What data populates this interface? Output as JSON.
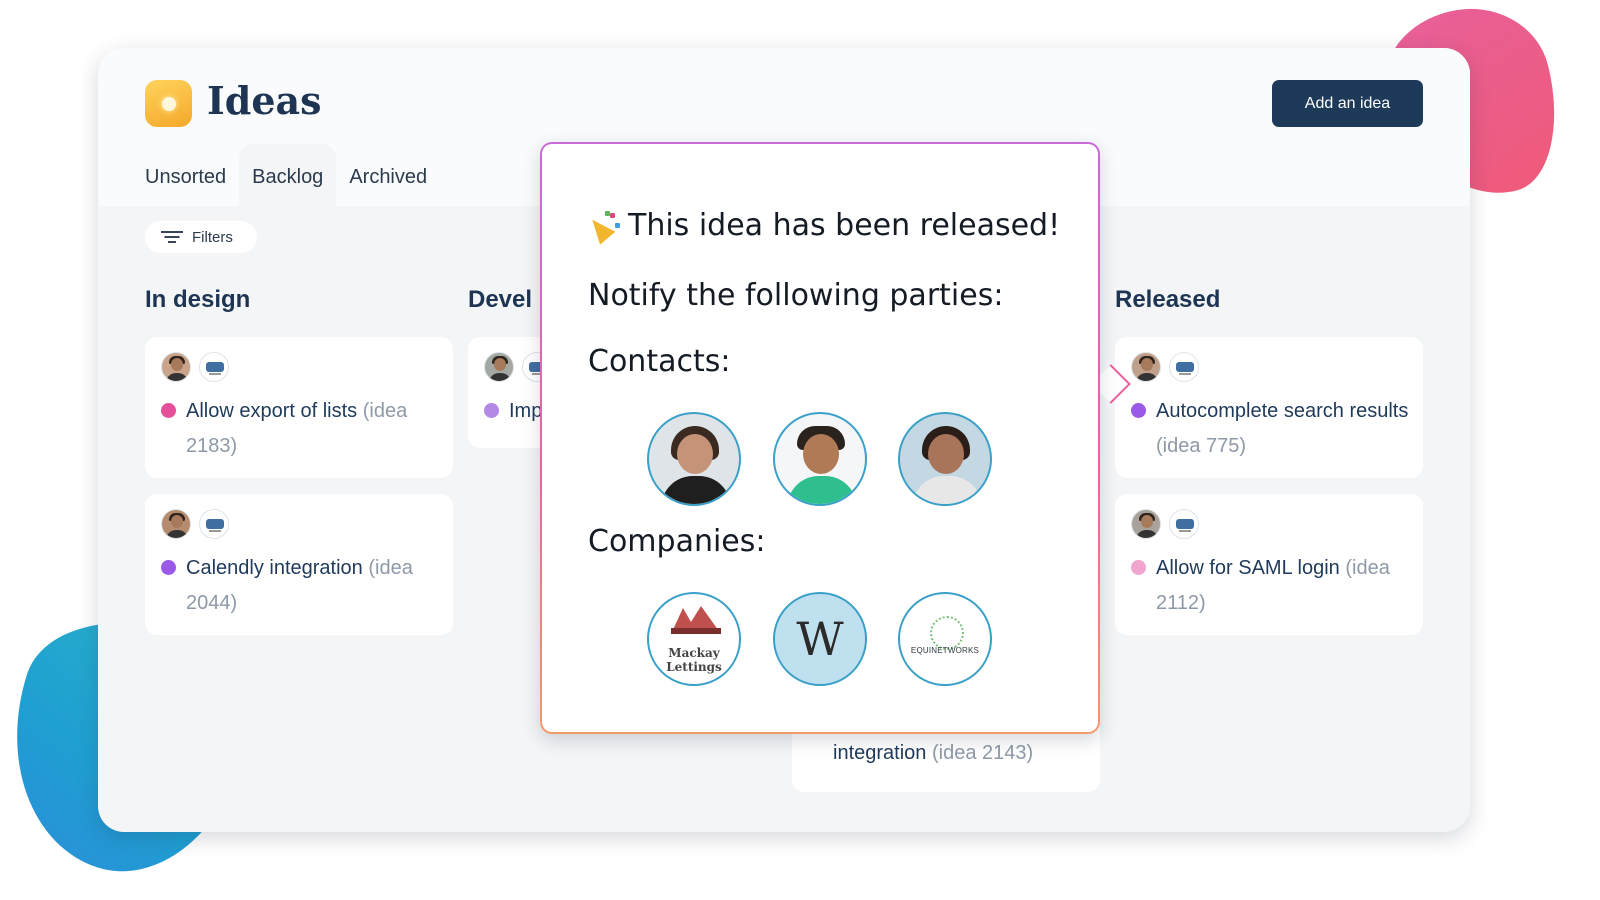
{
  "app": {
    "title": "Ideas",
    "add_button": "Add an idea"
  },
  "tabs": [
    {
      "label": "Unsorted",
      "active": false
    },
    {
      "label": "Backlog",
      "active": true
    },
    {
      "label": "Archived",
      "active": false
    }
  ],
  "filters": {
    "label": "Filters"
  },
  "columns": [
    {
      "title": "In design",
      "cards": [
        {
          "title": "Allow export of lists",
          "ref": "(idea 2183)",
          "dot_color": "#e64f9a"
        },
        {
          "title": "Calendly integration",
          "ref": "(idea 2044)",
          "dot_color": "#9a59e6"
        }
      ]
    },
    {
      "title": "Devel",
      "cards": [
        {
          "title": "Imp",
          "dot_color": "#b489e6"
        }
      ]
    },
    {
      "title": "Released",
      "cards": [
        {
          "title": "Autocomplete search results",
          "ref": "(idea 775)",
          "dot_color": "#9a59e6"
        },
        {
          "title": "Allow for SAML login",
          "ref": "(idea 2112)",
          "dot_color": "#f1a6cf"
        }
      ]
    }
  ],
  "hidden_card": {
    "title": "integration",
    "ref": "(idea 2143)"
  },
  "popover": {
    "title": "This idea has been released!",
    "notify": "Notify the following parties:",
    "contacts_label": "Contacts:",
    "companies_label": "Companies:",
    "companies": [
      "Mackay Lettings",
      "W",
      "EQUINETWORKS"
    ]
  },
  "colors": {
    "accent_navy": "#1e3a59",
    "popover_gradient": [
      "#c86bd8",
      "#ef5fa0",
      "#f39a6a"
    ],
    "blob_pink": "#ef5a8a",
    "blob_teal": "#2aa8cf"
  },
  "icons": [
    "lightbulb-icon",
    "filter-icon",
    "party-popper-icon"
  ]
}
